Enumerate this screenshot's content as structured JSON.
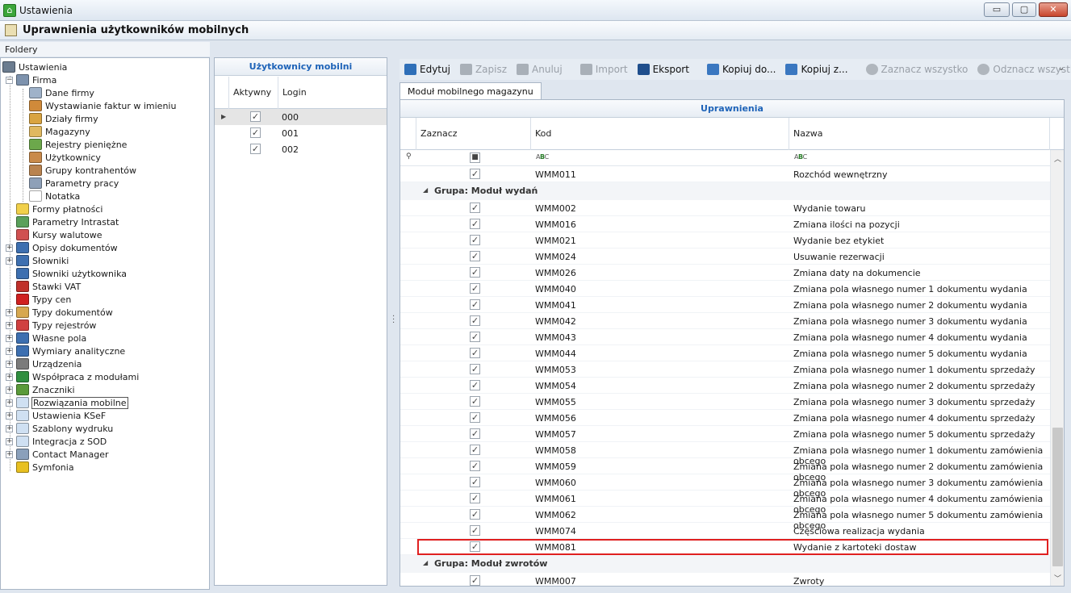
{
  "window": {
    "title": "Ustawienia",
    "buttons": {
      "minimize": "▭",
      "maximize": "▢",
      "close": "✕"
    }
  },
  "header": {
    "title": "Uprawnienia użytkowników mobilnych"
  },
  "folders": {
    "label": "Foldery",
    "items": [
      {
        "label": "Ustawienia",
        "level": 0,
        "expander": "",
        "icon": "tools-icon"
      },
      {
        "label": "Firma",
        "level": 1,
        "expander": "−",
        "icon": "company-icon"
      },
      {
        "label": "Dane firmy",
        "level": 2,
        "expander": "",
        "icon": "company-data-icon"
      },
      {
        "label": "Wystawianie faktur w imieniu",
        "level": 2,
        "expander": "",
        "icon": "person-icon"
      },
      {
        "label": "Działy firmy",
        "level": 2,
        "expander": "",
        "icon": "departments-icon"
      },
      {
        "label": "Magazyny",
        "level": 2,
        "expander": "",
        "icon": "warehouse-icon"
      },
      {
        "label": "Rejestry pieniężne",
        "level": 2,
        "expander": "",
        "icon": "money-icon"
      },
      {
        "label": "Użytkownicy",
        "level": 2,
        "expander": "",
        "icon": "users-icon"
      },
      {
        "label": "Grupy kontrahentów",
        "level": 2,
        "expander": "",
        "icon": "groups-icon"
      },
      {
        "label": "Parametry pracy",
        "level": 2,
        "expander": "",
        "icon": "parameters-icon"
      },
      {
        "label": "Notatka",
        "level": 2,
        "expander": "",
        "icon": "note-icon"
      },
      {
        "label": "Formy płatności",
        "level": 1,
        "expander": "",
        "icon": "payment-icon"
      },
      {
        "label": "Parametry Intrastat",
        "level": 1,
        "expander": "",
        "icon": "intrastat-icon"
      },
      {
        "label": "Kursy walutowe",
        "level": 1,
        "expander": "",
        "icon": "chart-icon"
      },
      {
        "label": "Opisy dokumentów",
        "level": 1,
        "expander": "+",
        "icon": "document-icon"
      },
      {
        "label": "Słowniki",
        "level": 1,
        "expander": "+",
        "icon": "dictionary-icon"
      },
      {
        "label": "Słowniki użytkownika",
        "level": 1,
        "expander": "",
        "icon": "dictionary-icon"
      },
      {
        "label": "Stawki VAT",
        "level": 1,
        "expander": "",
        "icon": "vat-icon"
      },
      {
        "label": "Typy cen",
        "level": 1,
        "expander": "",
        "icon": "price-icon"
      },
      {
        "label": "Typy dokumentów",
        "level": 1,
        "expander": "+",
        "icon": "document-types-icon"
      },
      {
        "label": "Typy rejestrów",
        "level": 1,
        "expander": "+",
        "icon": "register-icon"
      },
      {
        "label": "Własne pola",
        "level": 1,
        "expander": "+",
        "icon": "custom-fields-icon"
      },
      {
        "label": "Wymiary analityczne",
        "level": 1,
        "expander": "+",
        "icon": "dimensions-icon"
      },
      {
        "label": "Urządzenia",
        "level": 1,
        "expander": "+",
        "icon": "printer-icon"
      },
      {
        "label": "Współpraca z modułami",
        "level": 1,
        "expander": "+",
        "icon": "modules-icon"
      },
      {
        "label": "Znaczniki",
        "level": 1,
        "expander": "+",
        "icon": "tags-icon"
      },
      {
        "label": "Rozwiązania mobilne",
        "level": 1,
        "expander": "+",
        "icon": "folder-icon",
        "selected": true
      },
      {
        "label": "Ustawienia KSeF",
        "level": 1,
        "expander": "+",
        "icon": "folder-icon"
      },
      {
        "label": "Szablony wydruku",
        "level": 1,
        "expander": "+",
        "icon": "folder-icon"
      },
      {
        "label": "Integracja z SOD",
        "level": 1,
        "expander": "+",
        "icon": "folder-icon"
      },
      {
        "label": "Contact Manager",
        "level": 1,
        "expander": "+",
        "icon": "contact-icon"
      },
      {
        "label": "Symfonia",
        "level": 1,
        "expander": "",
        "icon": "symfonia-icon"
      }
    ]
  },
  "users_panel": {
    "title": "Użytkownicy mobilni",
    "columns": {
      "active": "Aktywny",
      "login": "Login"
    },
    "rows": [
      {
        "login": "000",
        "active": true,
        "current": true
      },
      {
        "login": "001",
        "active": true,
        "current": false
      },
      {
        "login": "002",
        "active": true,
        "current": false
      }
    ]
  },
  "toolbar": {
    "buttons": [
      {
        "label": "Edytuj",
        "icon": "edit-icon",
        "enabled": true,
        "color": "#2f6fb8"
      },
      {
        "label": "Zapisz",
        "icon": "save-icon",
        "enabled": false,
        "color": "#a9b0b8"
      },
      {
        "label": "Anuluj",
        "icon": "undo-icon",
        "enabled": false,
        "color": "#a9b0b8"
      },
      {
        "sep": true
      },
      {
        "label": "Import",
        "icon": "import-folder-icon",
        "enabled": false,
        "color": "#a9b0b8"
      },
      {
        "label": "Eksport",
        "icon": "export-folder-icon",
        "enabled": true,
        "color": "#1f4e8c"
      },
      {
        "sep": true
      },
      {
        "label": "Kopiuj do...",
        "icon": "copy-to-icon",
        "enabled": true,
        "color": "#3a77c0"
      },
      {
        "label": "Kopiuj z...",
        "icon": "copy-from-icon",
        "enabled": true,
        "color": "#3a77c0"
      },
      {
        "sep": true
      },
      {
        "label": "Zaznacz wszystko",
        "icon": "check-all-icon",
        "enabled": false,
        "color": "#b0b6bd"
      },
      {
        "label": "Odznacz wszystko",
        "icon": "uncheck-all-icon",
        "enabled": false,
        "color": "#b0b6bd"
      }
    ],
    "more": "⌄"
  },
  "tab": {
    "label": "Moduł mobilnego magazynu"
  },
  "grid": {
    "title": "Uprawnienia",
    "columns": {
      "select": "Zaznacz",
      "code": "Kod",
      "name": "Nazwa"
    },
    "filter_indicator": "⚲",
    "rows": [
      {
        "type": "row",
        "kod": "WMM011",
        "nazwa": "Rozchód wewnętrzny"
      },
      {
        "type": "group",
        "title": "Grupa: Moduł wydań"
      },
      {
        "type": "row",
        "kod": "WMM002",
        "nazwa": "Wydanie towaru"
      },
      {
        "type": "row",
        "kod": "WMM016",
        "nazwa": "Zmiana ilości na pozycji"
      },
      {
        "type": "row",
        "kod": "WMM021",
        "nazwa": "Wydanie bez etykiet"
      },
      {
        "type": "row",
        "kod": "WMM024",
        "nazwa": "Usuwanie rezerwacji"
      },
      {
        "type": "row",
        "kod": "WMM026",
        "nazwa": "Zmiana daty na dokumencie"
      },
      {
        "type": "row",
        "kod": "WMM040",
        "nazwa": "Zmiana pola własnego numer 1 dokumentu wydania"
      },
      {
        "type": "row",
        "kod": "WMM041",
        "nazwa": "Zmiana pola własnego numer 2 dokumentu wydania"
      },
      {
        "type": "row",
        "kod": "WMM042",
        "nazwa": "Zmiana pola własnego numer 3 dokumentu wydania"
      },
      {
        "type": "row",
        "kod": "WMM043",
        "nazwa": "Zmiana pola własnego numer 4 dokumentu wydania"
      },
      {
        "type": "row",
        "kod": "WMM044",
        "nazwa": "Zmiana pola własnego numer 5 dokumentu wydania"
      },
      {
        "type": "row",
        "kod": "WMM053",
        "nazwa": "Zmiana pola własnego numer 1 dokumentu sprzedaży"
      },
      {
        "type": "row",
        "kod": "WMM054",
        "nazwa": "Zmiana pola własnego numer 2 dokumentu sprzedaży"
      },
      {
        "type": "row",
        "kod": "WMM055",
        "nazwa": "Zmiana pola własnego numer 3 dokumentu sprzedaży"
      },
      {
        "type": "row",
        "kod": "WMM056",
        "nazwa": "Zmiana pola własnego numer 4 dokumentu sprzedaży"
      },
      {
        "type": "row",
        "kod": "WMM057",
        "nazwa": "Zmiana pola własnego numer 5 dokumentu sprzedaży"
      },
      {
        "type": "row",
        "kod": "WMM058",
        "nazwa": "Zmiana pola własnego numer 1 dokumentu zamówienia obcego"
      },
      {
        "type": "row",
        "kod": "WMM059",
        "nazwa": "Zmiana pola własnego numer 2 dokumentu zamówienia obcego"
      },
      {
        "type": "row",
        "kod": "WMM060",
        "nazwa": "Zmiana pola własnego numer 3 dokumentu zamówienia obcego"
      },
      {
        "type": "row",
        "kod": "WMM061",
        "nazwa": "Zmiana pola własnego numer 4 dokumentu zamówienia obcego"
      },
      {
        "type": "row",
        "kod": "WMM062",
        "nazwa": "Zmiana pola własnego numer 5 dokumentu zamówienia obcego"
      },
      {
        "type": "row",
        "kod": "WMM074",
        "nazwa": "Częściowa realizacja wydania"
      },
      {
        "type": "row",
        "kod": "WMM081",
        "nazwa": "Wydanie z kartoteki dostaw",
        "highlighted": true
      },
      {
        "type": "group",
        "title": "Grupa: Moduł zwrotów"
      },
      {
        "type": "row",
        "kod": "WMM007",
        "nazwa": "Zwroty"
      }
    ],
    "highlight_color": "#e02020"
  }
}
